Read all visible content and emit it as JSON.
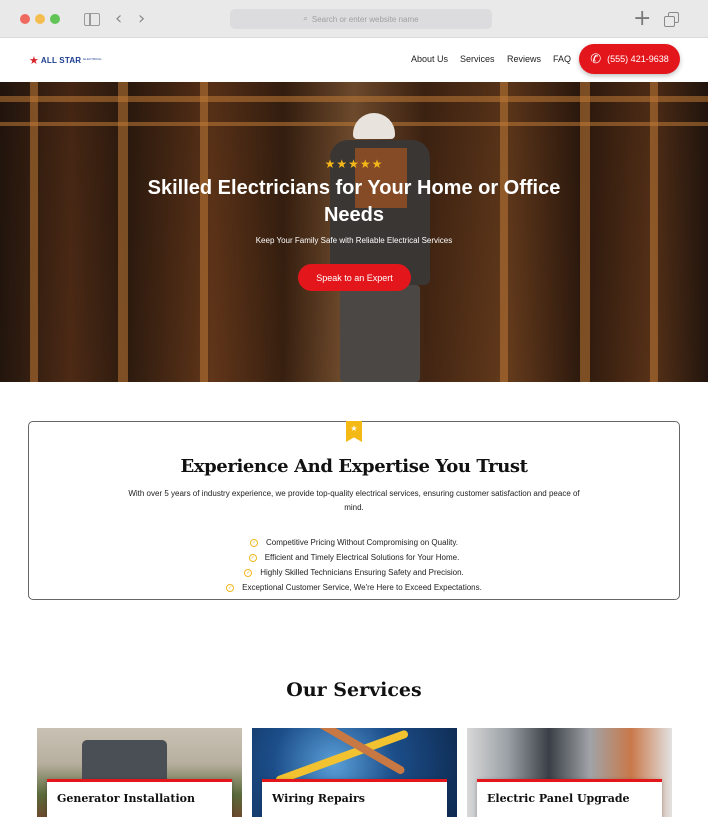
{
  "browser": {
    "address_placeholder": "Search or enter website name"
  },
  "site": {
    "logo_text": "ALL STAR",
    "logo_sub": "ELECTRICAL",
    "nav": [
      "About Us",
      "Services",
      "Reviews",
      "FAQ"
    ],
    "phone": "(555) 421-9638"
  },
  "hero": {
    "stars": "★★★★★",
    "title": "Skilled Electricians for Your Home or Office Needs",
    "subtitle": "Keep Your Family Safe with Reliable Electrical Services",
    "cta": "Speak to an Expert"
  },
  "experience": {
    "title": "Experience And Expertise You Trust",
    "description": "With over 5 years of industry experience, we provide top-quality electrical services, ensuring customer satisfaction and peace of mind.",
    "features": [
      "Competitive Pricing Without Compromising on Quality.",
      "Efficient and Timely Electrical Solutions for Your Home.",
      "Highly Skilled Technicians Ensuring Safety and Precision.",
      "Exceptional Customer Service, We're Here to Exceed Expectations."
    ]
  },
  "services": {
    "title": "Our Services",
    "items": [
      "Generator Installation",
      "Wiring Repairs",
      "Electric Panel Upgrade"
    ]
  },
  "colors": {
    "accent": "#e3161b",
    "star": "#f6b818",
    "brand_blue": "#1b3d8f"
  }
}
